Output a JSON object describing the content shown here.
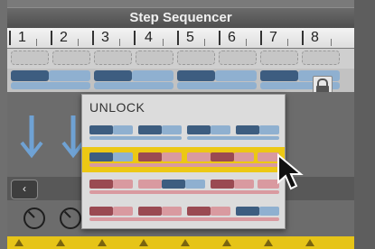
{
  "panel": {
    "title": "Step Sequencer",
    "step_numbers": [
      "1",
      "2",
      "3",
      "4",
      "5",
      "6",
      "7",
      "8"
    ]
  },
  "popup": {
    "title": "UNLOCK",
    "highlighted_item": 1
  },
  "colors": {
    "dark_blue": "#3d5d80",
    "light_blue": "#8fb0d0",
    "dark_red": "#9a4a52",
    "pink": "#d99aa0",
    "highlight": "#ecc814"
  },
  "icons": [
    "lock-icon",
    "down-arrow-icon",
    "back-icon",
    "knob-icon",
    "mouse-cursor-icon"
  ]
}
